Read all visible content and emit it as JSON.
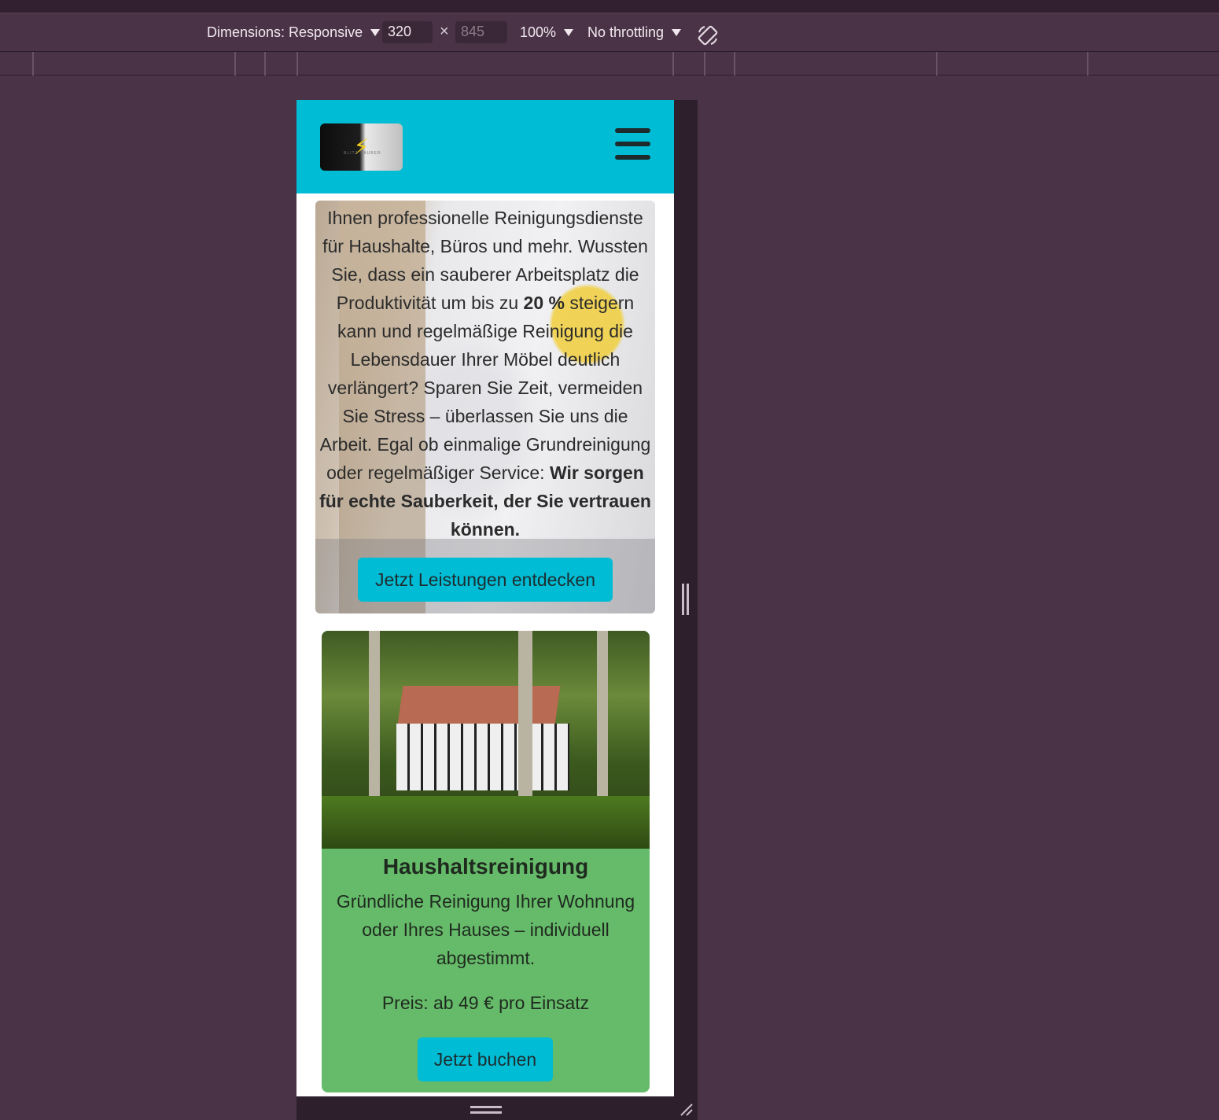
{
  "toolbar": {
    "dimensions_label": "Dimensions: Responsive",
    "width_value": "320",
    "height_placeholder": "845",
    "times_symbol": "×",
    "zoom_label": "100%",
    "throttling_label": "No throttling",
    "rotate_icon": "rotate-device-icon"
  },
  "navbar": {
    "logo_text": "BLITZ SAUBER",
    "menu_icon": "hamburger-menu-icon"
  },
  "hero": {
    "text_part1": "Ihnen professionelle Reinigungsdienste für Haushalte, Büros und mehr. Wussten Sie, dass ein sauberer Arbeitsplatz die Produktivität um bis zu ",
    "text_bold1": "20 %",
    "text_part2": " steigern kann und regelmäßige Reinigung die Lebensdauer Ihrer Möbel deutlich verlängert? Sparen Sie Zeit, vermeiden Sie Stress – überlassen Sie uns die Arbeit. Egal ob einmalige Grundreinigung oder regelmäßiger Service: ",
    "text_bold2": "Wir sorgen für echte Sauberkeit, der Sie vertrauen können.",
    "cta_label": "Jetzt Leistungen entdecken"
  },
  "service_card": {
    "title": "Haushaltsreinigung",
    "description": "Gründliche Reinigung Ihrer Wohnung oder Ihres Hauses – individuell abgestimmt.",
    "price": "Preis: ab 49 € pro Einsatz",
    "button_label": "Jetzt buchen"
  },
  "colors": {
    "accent": "#00bcd4",
    "card_green": "#66bb6a",
    "devtools_bg": "#4a3347"
  }
}
